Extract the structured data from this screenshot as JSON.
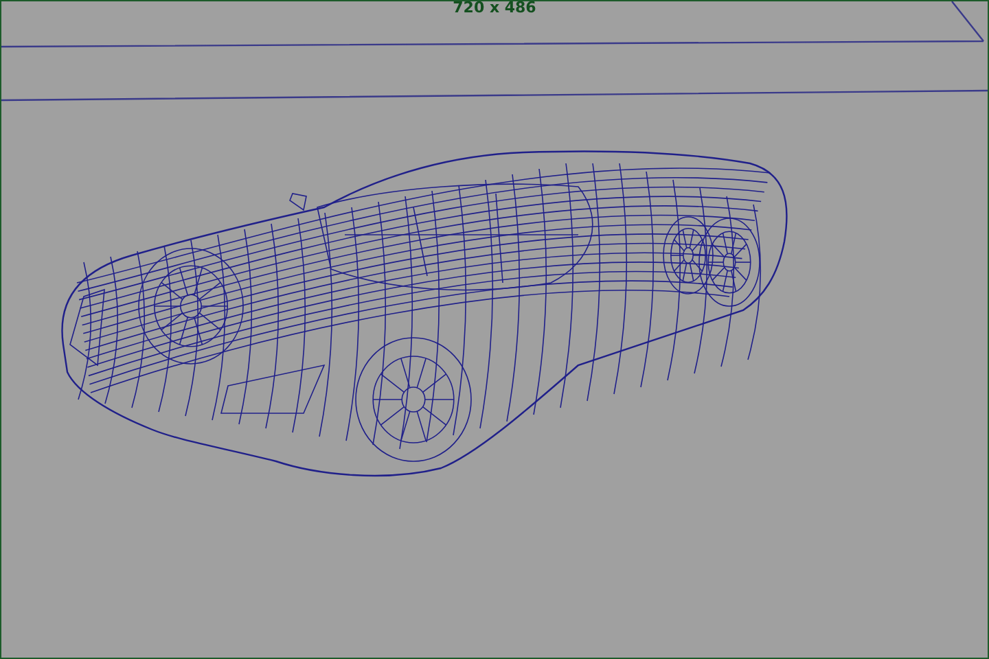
{
  "viewport": {
    "resolution_label": "720 x 486"
  }
}
